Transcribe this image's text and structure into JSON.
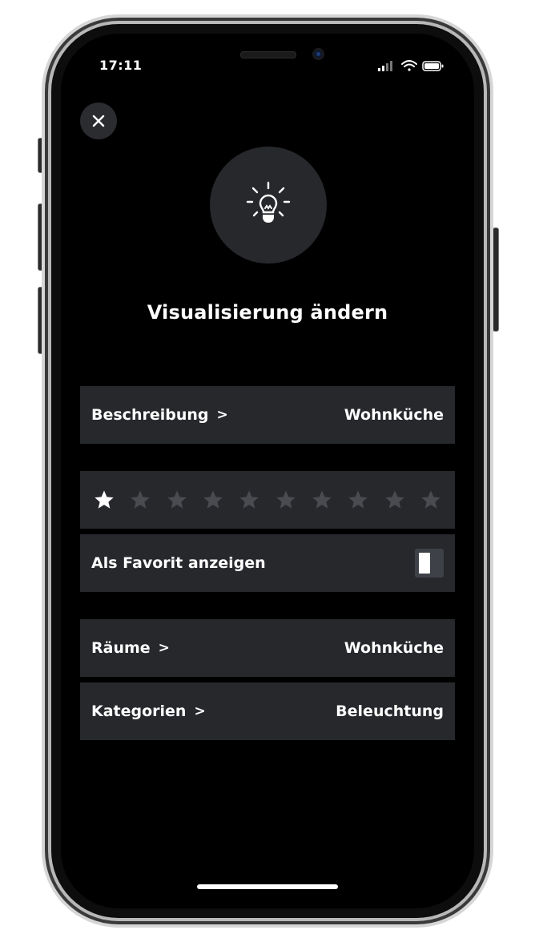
{
  "status_bar": {
    "time": "17:11"
  },
  "header": {
    "title": "Visualisierung ändern",
    "hero_icon": "lightbulb-icon",
    "close_icon": "close-icon"
  },
  "rows": {
    "description": {
      "label": "Beschreibung",
      "chevron": ">",
      "value": "Wohnküche"
    },
    "rating": {
      "max": 10,
      "value": 1
    },
    "favorite": {
      "label": "Als Favorit anzeigen",
      "enabled": false
    },
    "rooms": {
      "label": "Räume",
      "chevron": ">",
      "value": "Wohnküche"
    },
    "categories": {
      "label": "Kategorien",
      "chevron": ">",
      "value": "Beleuchtung"
    }
  },
  "colors": {
    "background": "#000000",
    "row": "#27282c",
    "star_active": "#ffffff",
    "star_inactive": "#4a4b50"
  }
}
